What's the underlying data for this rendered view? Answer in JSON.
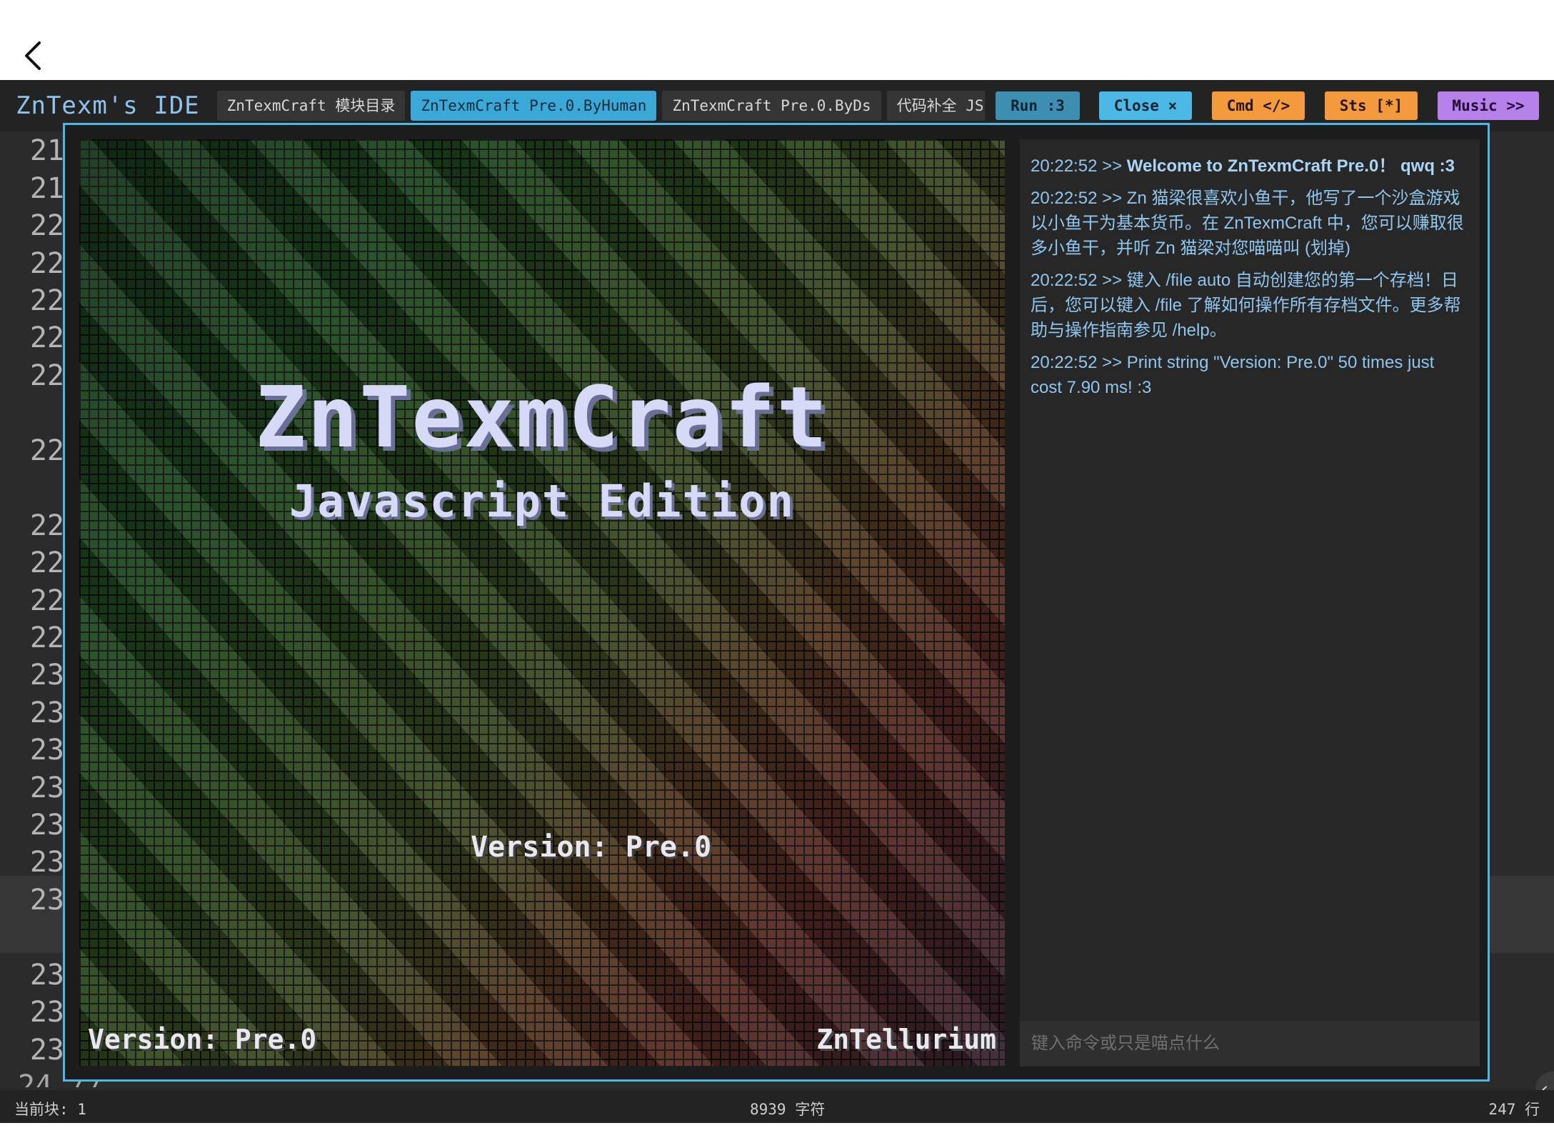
{
  "nav": {
    "back_icon": "chevron-left-icon"
  },
  "header": {
    "title": "ZnTexm's IDE",
    "tabs": [
      {
        "label": "ZnTexmCraft 模块目录",
        "active": false
      },
      {
        "label": "ZnTexmCraft Pre.0.ByHuman",
        "active": true
      },
      {
        "label": "ZnTexmCraft Pre.0.ByDs",
        "active": false
      },
      {
        "label": "代码补全 JS",
        "active": false
      }
    ],
    "buttons": {
      "run": "Run :3",
      "close": "Close ×",
      "cmd": "Cmd </>",
      "sts": "Sts [*]",
      "music": "Music >>"
    },
    "button_colors": {
      "run": "#3c8fb0",
      "close": "#4bb8e6",
      "cmd": "#f39b3c",
      "sts": "#f39b3c",
      "music": "#b681e8"
    }
  },
  "editor": {
    "line_numbers": [
      "21",
      "21",
      "22",
      "22",
      "22",
      "22",
      "22",
      "22",
      "22",
      "22",
      "22",
      "22",
      "23",
      "23",
      "23",
      "23",
      "23",
      "23",
      "23",
      "23",
      "23",
      "23"
    ],
    "partial_line_text": "24 // ...",
    "side_toggle_icon": "chevron-left-icon"
  },
  "game": {
    "title": "ZnTexmCraft",
    "subtitle": "Javascript Edition",
    "version_center": "Version: Pre.0",
    "version_corner": "Version: Pre.0",
    "author": "ZnTellurium"
  },
  "console": {
    "log": [
      {
        "time": "20:22:52 >> ",
        "text": "Welcome to ZnTexmCraft Pre.0！ qwq :3"
      },
      {
        "time": "20:22:52 >> ",
        "text": "Zn 猫梁很喜欢小鱼干，他写了一个沙盒游戏以小鱼干为基本货币。在 ZnTexmCraft 中，您可以赚取很多小鱼干，并听 Zn 猫梁对您喵喵叫 (划掉)"
      },
      {
        "time": "20:22:52 >> ",
        "text": "键入 /file auto 自动创建您的第一个存档！日后，您可以键入 /file 了解如何操作所有存档文件。更多帮助与操作指南参见 /help。"
      },
      {
        "time": "20:22:52 >> ",
        "text": "Print string \"Version: Pre.0\" 50 times just cost 7.90 ms! :3"
      }
    ],
    "input_placeholder": "键入命令或只是喵点什么"
  },
  "status": {
    "block": "当前块: 1",
    "chars": "8939 字符",
    "lines": "247 行"
  }
}
